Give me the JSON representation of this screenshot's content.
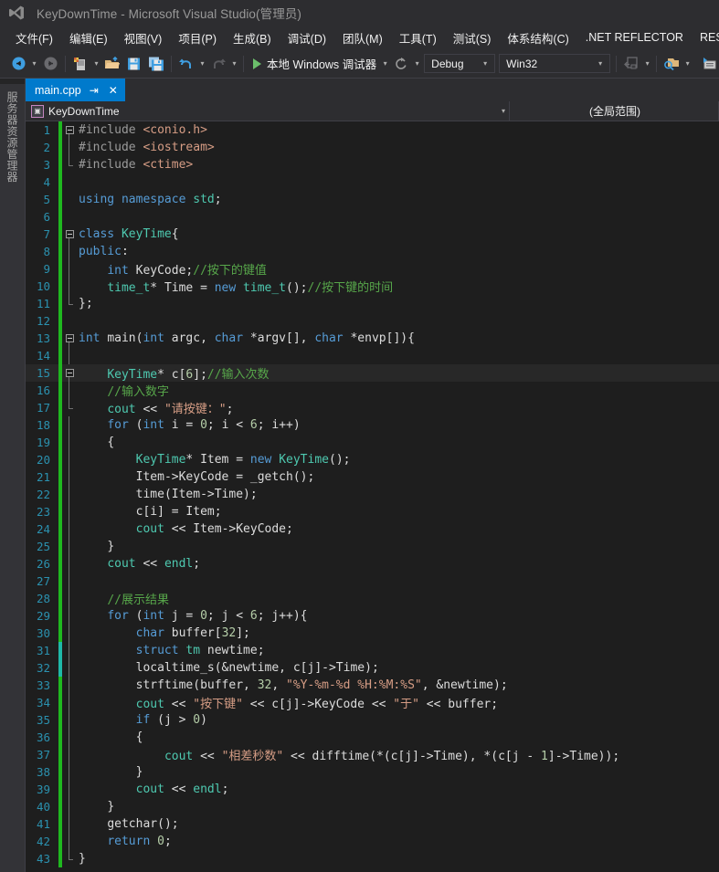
{
  "window": {
    "title": "KeyDownTime - Microsoft Visual Studio(管理员)",
    "logo_icon": "visual-studio-logo-icon"
  },
  "menubar": {
    "items": [
      "文件(F)",
      "编辑(E)",
      "视图(V)",
      "项目(P)",
      "生成(B)",
      "调试(D)",
      "团队(M)",
      "工具(T)",
      "测试(S)",
      "体系结构(C)",
      ".NET REFLECTOR",
      "RESHA"
    ]
  },
  "toolbar": {
    "navigate_back_icon": "navigate-back-icon",
    "navigate_forward_icon": "navigate-forward-icon",
    "new_file_icon": "new-file-icon",
    "open_file_icon": "open-file-icon",
    "save_icon": "save-icon",
    "save_all_icon": "save-all-icon",
    "undo_icon": "undo-icon",
    "redo_icon": "redo-icon",
    "run_label": "本地 Windows 调试器",
    "run_play_icon": "play-triangle-icon",
    "refresh_icon": "refresh-icon",
    "config_value": "Debug",
    "platform_value": "Win32",
    "step_icon": "step-into-icon",
    "find_icon": "find-in-files-icon",
    "toolbox_icon": "toolbox-icon",
    "properties_icon": "properties-window-icon"
  },
  "sidebar": {
    "vertical_tab": "服务器资源管理器"
  },
  "tabs": {
    "active": {
      "label": "main.cpp",
      "pin_icon": "pin-icon",
      "close_icon": "close-icon"
    }
  },
  "navbar": {
    "project_icon": "cpp-project-icon",
    "project": "KeyDownTime",
    "scope": "(全局范围)",
    "dropdown_icon": "chevron-down-icon"
  },
  "editor": {
    "current_line": 15,
    "colors": {
      "background": "#1e1e1e",
      "keyword": "#569cd6",
      "type": "#4ec9b0",
      "string": "#d69d85",
      "comment": "#57a64a",
      "plain": "#dcdcdc",
      "number": "#b5cea8",
      "line_number": "#2b91af",
      "change_bar_saved": "#1fb81f",
      "change_bar_unsaved": "#1fb8a8",
      "accent": "#007acc"
    },
    "lines": [
      {
        "n": 1,
        "change": "green",
        "outline": "collapse",
        "text": "#include <conio.h>"
      },
      {
        "n": 2,
        "change": "green",
        "outline": "line",
        "text": "#include <iostream>"
      },
      {
        "n": 3,
        "change": "green",
        "outline": "elbow",
        "text": "#include <ctime>"
      },
      {
        "n": 4,
        "change": "green",
        "outline": "none",
        "text": ""
      },
      {
        "n": 5,
        "change": "green",
        "outline": "none",
        "text": "using namespace std;"
      },
      {
        "n": 6,
        "change": "green",
        "outline": "none",
        "text": ""
      },
      {
        "n": 7,
        "change": "green",
        "outline": "collapse",
        "text": "class KeyTime{"
      },
      {
        "n": 8,
        "change": "green",
        "outline": "line",
        "text": "public:"
      },
      {
        "n": 9,
        "change": "green",
        "outline": "line",
        "text": "    int KeyCode;//按下的键值"
      },
      {
        "n": 10,
        "change": "green",
        "outline": "line",
        "text": "    time_t* Time = new time_t();//按下键的时间"
      },
      {
        "n": 11,
        "change": "green",
        "outline": "elbow",
        "text": "};"
      },
      {
        "n": 12,
        "change": "green",
        "outline": "none",
        "text": ""
      },
      {
        "n": 13,
        "change": "green",
        "outline": "collapse",
        "text": "int main(int argc, char *argv[], char *envp[]){"
      },
      {
        "n": 14,
        "change": "green",
        "outline": "line",
        "text": ""
      },
      {
        "n": 15,
        "change": "green",
        "outline": "collapse",
        "text": "    KeyTime* c[6];//输入次数"
      },
      {
        "n": 16,
        "change": "green",
        "outline": "line",
        "text": "    //输入数字"
      },
      {
        "n": 17,
        "change": "green",
        "outline": "elbow",
        "text": "    cout << \"请按键：\";"
      },
      {
        "n": 18,
        "change": "green",
        "outline": "line",
        "text": "    for (int i = 0; i < 6; i++)"
      },
      {
        "n": 19,
        "change": "green",
        "outline": "line",
        "text": "    {"
      },
      {
        "n": 20,
        "change": "green",
        "outline": "line",
        "text": "        KeyTime* Item = new KeyTime();"
      },
      {
        "n": 21,
        "change": "green",
        "outline": "line",
        "text": "        Item->KeyCode = _getch();"
      },
      {
        "n": 22,
        "change": "green",
        "outline": "line",
        "text": "        time(Item->Time);"
      },
      {
        "n": 23,
        "change": "green",
        "outline": "line",
        "text": "        c[i] = Item;"
      },
      {
        "n": 24,
        "change": "green",
        "outline": "line",
        "text": "        cout << Item->KeyCode;"
      },
      {
        "n": 25,
        "change": "green",
        "outline": "line",
        "text": "    }"
      },
      {
        "n": 26,
        "change": "green",
        "outline": "line",
        "text": "    cout << endl;"
      },
      {
        "n": 27,
        "change": "green",
        "outline": "line",
        "text": ""
      },
      {
        "n": 28,
        "change": "green",
        "outline": "line",
        "text": "    //展示结果"
      },
      {
        "n": 29,
        "change": "green",
        "outline": "line",
        "text": "    for (int j = 0; j < 6; j++){"
      },
      {
        "n": 30,
        "change": "green",
        "outline": "line",
        "text": "        char buffer[32];"
      },
      {
        "n": 31,
        "change": "teal",
        "outline": "line",
        "text": "        struct tm newtime;"
      },
      {
        "n": 32,
        "change": "teal",
        "outline": "line",
        "text": "        localtime_s(&newtime, c[j]->Time);"
      },
      {
        "n": 33,
        "change": "green",
        "outline": "line",
        "text": "        strftime(buffer, 32, \"%Y-%m-%d %H:%M:%S\", &newtime);"
      },
      {
        "n": 34,
        "change": "green",
        "outline": "line",
        "text": "        cout << \"按下键\" << c[j]->KeyCode << \"于\" << buffer;"
      },
      {
        "n": 35,
        "change": "green",
        "outline": "line",
        "text": "        if (j > 0)"
      },
      {
        "n": 36,
        "change": "green",
        "outline": "line",
        "text": "        {"
      },
      {
        "n": 37,
        "change": "green",
        "outline": "line",
        "text": "            cout << \"相差秒数\" << difftime(*(c[j]->Time), *(c[j - 1]->Time));"
      },
      {
        "n": 38,
        "change": "green",
        "outline": "line",
        "text": "        }"
      },
      {
        "n": 39,
        "change": "green",
        "outline": "line",
        "text": "        cout << endl;"
      },
      {
        "n": 40,
        "change": "green",
        "outline": "line",
        "text": "    }"
      },
      {
        "n": 41,
        "change": "green",
        "outline": "line",
        "text": "    getchar();"
      },
      {
        "n": 42,
        "change": "green",
        "outline": "line",
        "text": "    return 0;"
      },
      {
        "n": 43,
        "change": "green",
        "outline": "elbow",
        "text": "}"
      }
    ]
  }
}
